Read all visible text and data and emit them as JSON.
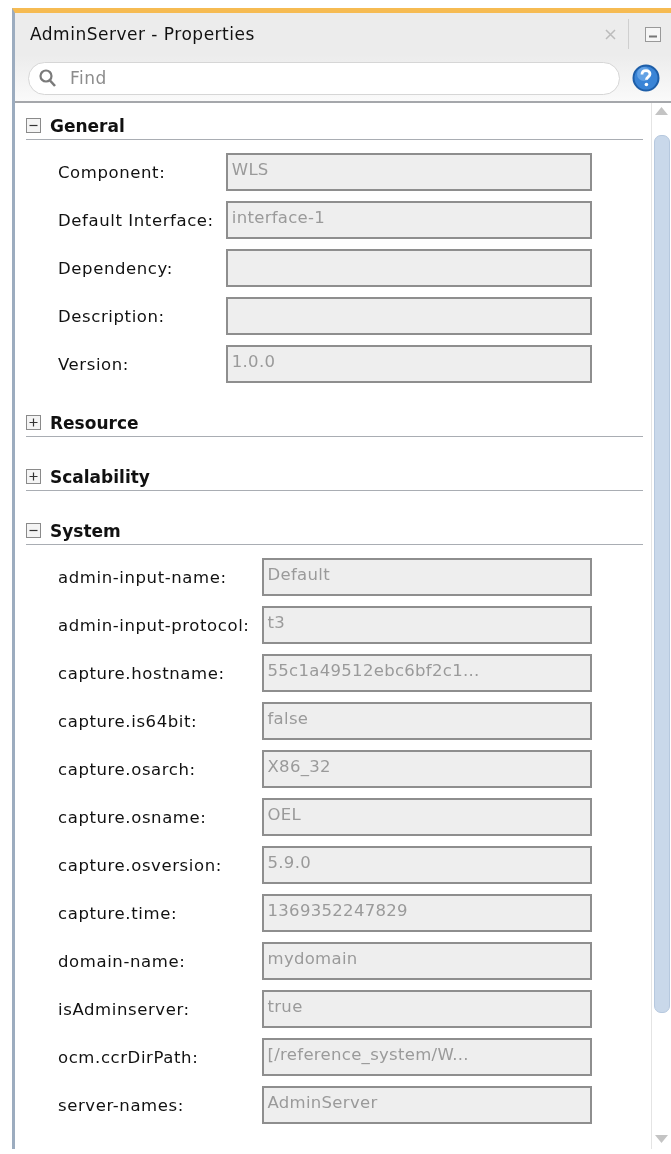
{
  "window": {
    "title": "AdminServer - Properties"
  },
  "search": {
    "placeholder": "Find"
  },
  "sections": [
    {
      "title": "General",
      "expanded": true,
      "properties": [
        {
          "label": "Component:",
          "value": "WLS"
        },
        {
          "label": "Default Interface:",
          "value": "interface-1"
        },
        {
          "label": "Dependency:"
        },
        {
          "label": "Description:"
        },
        {
          "label": "Version:",
          "value": "1.0.0"
        }
      ]
    },
    {
      "title": "Resource",
      "expanded": false
    },
    {
      "title": "Scalability",
      "expanded": false
    },
    {
      "title": "System",
      "expanded": true,
      "properties": [
        {
          "label": "admin-input-name:",
          "value": "Default"
        },
        {
          "label": "admin-input-protocol:",
          "value": "t3"
        },
        {
          "label": "capture.hostname:",
          "value": "55c1a49512ebc6bf2c1..."
        },
        {
          "label": "capture.is64bit:",
          "value": "false"
        },
        {
          "label": "capture.osarch:",
          "value": "X86_32"
        },
        {
          "label": "capture.osname:",
          "value": "OEL"
        },
        {
          "label": "capture.osversion:",
          "value": "5.9.0"
        },
        {
          "label": "capture.time:",
          "value": "1369352247829"
        },
        {
          "label": "domain-name:",
          "value": "mydomain"
        },
        {
          "label": "isAdminserver:",
          "value": "true"
        },
        {
          "label": "ocm.ccrDirPath:",
          "value": "[/reference_system/W..."
        },
        {
          "label": "server-names:",
          "value": "AdminServer"
        }
      ]
    }
  ]
}
